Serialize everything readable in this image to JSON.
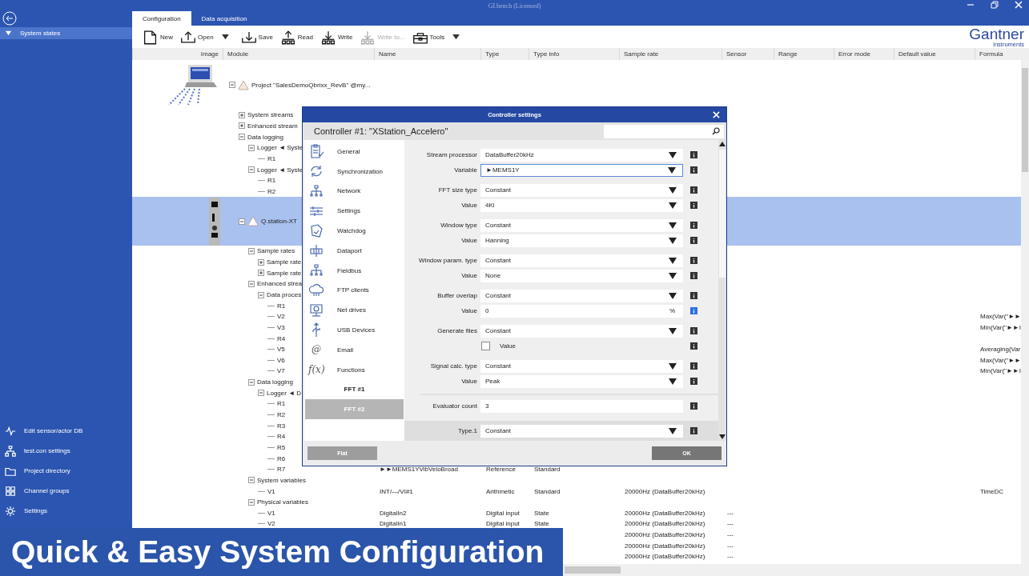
{
  "window": {
    "title": "GI.bench (Licensed)"
  },
  "sidebar": {
    "top_items": [
      {
        "label": "System states",
        "expanded": true,
        "selected": true
      }
    ],
    "bottom_items": [
      {
        "label": "Edit sensor/actor DB"
      },
      {
        "label": "test.con settings"
      },
      {
        "label": "Project directory"
      },
      {
        "label": "Channel groups"
      },
      {
        "label": "Settings"
      }
    ]
  },
  "tabs": [
    {
      "label": "Configuration",
      "selected": true
    },
    {
      "label": "Data acquisition",
      "selected": false
    }
  ],
  "toolbar": [
    {
      "label": "New",
      "disabled": false,
      "dropdown": false
    },
    {
      "label": "Open",
      "disabled": false,
      "dropdown": true
    },
    {
      "label": "Save",
      "disabled": false,
      "dropdown": false
    },
    {
      "label": "Read",
      "disabled": false,
      "dropdown": false
    },
    {
      "label": "Write",
      "disabled": false,
      "dropdown": false
    },
    {
      "label": "Write to...",
      "disabled": true,
      "dropdown": false
    },
    {
      "label": "Tools",
      "disabled": false,
      "dropdown": true
    }
  ],
  "logo": {
    "name": "Gantner",
    "sub": "instruments"
  },
  "table": {
    "columns": [
      "Image",
      "Module",
      "Name",
      "Type",
      "Type info",
      "Sample rate",
      "Sensor",
      "Range",
      "Error mode",
      "Default value",
      "Formula"
    ]
  },
  "tree": [
    {
      "label": "Project \"SalesDemoQbrixx_RevB\" @my...",
      "kind": "project",
      "expanded": true,
      "selected": false,
      "children": [
        {
          "label": "System streams",
          "kind": "folder",
          "expanded": false,
          "selected": false
        },
        {
          "label": "Enhanced stream",
          "kind": "folder",
          "expanded": false,
          "selected": false
        },
        {
          "label": "Data logging",
          "kind": "folder",
          "expanded": true,
          "selected": false,
          "children": [
            {
              "label": "Logger ◄ Syste",
              "kind": "folder",
              "expanded": true,
              "selected": false,
              "children": [
                {
                  "label": "R1",
                  "kind": "channel",
                  "selected": false
                }
              ]
            },
            {
              "label": "Logger ◄ Syste",
              "kind": "folder",
              "expanded": true,
              "selected": false,
              "children": [
                {
                  "label": "R1",
                  "kind": "channel",
                  "selected": false
                },
                {
                  "label": "R2",
                  "kind": "channel",
                  "selected": false
                }
              ]
            }
          ]
        },
        {
          "label": "Q.station-XT",
          "kind": "controller",
          "expanded": true,
          "selected": true,
          "children": [
            {
              "label": "Sample rates",
              "kind": "folder",
              "expanded": true,
              "selected": false,
              "children": [
                {
                  "label": "Sample rate",
                  "kind": "folder",
                  "expanded": false,
                  "selected": false
                },
                {
                  "label": "Sample rate",
                  "kind": "folder",
                  "expanded": false,
                  "selected": false
                }
              ]
            },
            {
              "label": "Enhanced strea",
              "kind": "folder",
              "expanded": true,
              "selected": false,
              "children": [
                {
                  "label": "Data proces",
                  "kind": "folder",
                  "expanded": true,
                  "selected": false,
                  "children": [
                    {
                      "label": "R1",
                      "kind": "channel",
                      "selected": false
                    },
                    {
                      "label": "V2",
                      "kind": "channel",
                      "selected": false,
                      "cells": {
                        "formula": "Max(Var(\"►►"
                      }
                    },
                    {
                      "label": "V3",
                      "kind": "channel",
                      "selected": false,
                      "cells": {
                        "formula": "Min(Var(\"►►I"
                      }
                    },
                    {
                      "label": "R4",
                      "kind": "channel",
                      "selected": false
                    },
                    {
                      "label": "V5",
                      "kind": "channel",
                      "selected": false,
                      "cells": {
                        "formula": "Averaging(Var"
                      }
                    },
                    {
                      "label": "V6",
                      "kind": "channel",
                      "selected": false,
                      "cells": {
                        "formula": "Max(Var(\"►►"
                      }
                    },
                    {
                      "label": "V7",
                      "kind": "channel",
                      "selected": false,
                      "cells": {
                        "formula": "Min(Var(\"►►I"
                      }
                    }
                  ]
                }
              ]
            },
            {
              "label": "Data logging",
              "kind": "folder",
              "expanded": true,
              "selected": false,
              "children": [
                {
                  "label": "Logger ◄ D",
                  "kind": "folder",
                  "expanded": true,
                  "selected": false,
                  "children": [
                    {
                      "label": "R1",
                      "kind": "channel",
                      "selected": false
                    },
                    {
                      "label": "R2",
                      "kind": "channel",
                      "selected": false
                    },
                    {
                      "label": "R3",
                      "kind": "channel",
                      "selected": false
                    },
                    {
                      "label": "R4",
                      "kind": "channel",
                      "selected": false
                    },
                    {
                      "label": "R5",
                      "kind": "channel",
                      "selected": false
                    },
                    {
                      "label": "R6",
                      "kind": "channel",
                      "selected": false
                    },
                    {
                      "label": "R7",
                      "kind": "channel",
                      "selected": false,
                      "cells": {
                        "name": "►►MEMS1YVibVeloBroad",
                        "type": "Reference",
                        "type_info": "Standard"
                      }
                    }
                  ]
                }
              ]
            },
            {
              "label": "System variables",
              "kind": "folder",
              "expanded": true,
              "selected": false,
              "children": [
                {
                  "label": "V1",
                  "kind": "channel",
                  "selected": false,
                  "cells": {
                    "name": "INT/—/VI#1",
                    "type": "Arithmetic",
                    "type_info": "Standard",
                    "sample_rate": "20000Hz (DataBuffer20kHz)",
                    "formula": "TimeDC"
                  }
                }
              ]
            },
            {
              "label": "Physical variables",
              "kind": "folder",
              "expanded": true,
              "selected": false,
              "children": [
                {
                  "label": "V1",
                  "kind": "channel",
                  "selected": false,
                  "cells": {
                    "name": "DigitalIn2",
                    "type": "Digital input",
                    "type_info": "State",
                    "sample_rate": "20000Hz (DataBuffer20kHz)",
                    "sensor": "---"
                  }
                },
                {
                  "label": "V2",
                  "kind": "channel",
                  "selected": false,
                  "cells": {
                    "name": "DigitalIn1",
                    "type": "Digital input",
                    "type_info": "State",
                    "sample_rate": "20000Hz (DataBuffer20kHz)",
                    "sensor": "---"
                  }
                },
                {
                  "kind": "channel",
                  "selected": false,
                  "cells": {
                    "sample_rate": "20000Hz (DataBuffer20kHz)",
                    "sensor": "---"
                  }
                },
                {
                  "kind": "channel",
                  "selected": false,
                  "cells": {
                    "sample_rate": "20000Hz (DataBuffer20kHz)",
                    "sensor": "---"
                  }
                },
                {
                  "kind": "channel",
                  "selected": false,
                  "cells": {
                    "sample_rate": "20000Hz (DataBuffer20kHz)",
                    "sensor": "---"
                  }
                }
              ]
            }
          ]
        }
      ]
    }
  ],
  "dialog": {
    "title": "Controller settings",
    "heading": "Controller #1: \"XStation_Accelero\"",
    "nav": [
      {
        "label": "General",
        "kind": "section",
        "selected": false
      },
      {
        "label": "Synchronization",
        "kind": "section",
        "selected": false
      },
      {
        "label": "Network",
        "kind": "section",
        "selected": false
      },
      {
        "label": "Settings",
        "kind": "section",
        "selected": false
      },
      {
        "label": "Watchdog",
        "kind": "section",
        "selected": false
      },
      {
        "label": "Dataport",
        "kind": "section",
        "selected": false
      },
      {
        "label": "Fieldbus",
        "kind": "section",
        "selected": false
      },
      {
        "label": "FTP clients",
        "kind": "section",
        "selected": false
      },
      {
        "label": "Net drives",
        "kind": "section",
        "selected": false
      },
      {
        "label": "USB Devices",
        "kind": "section",
        "selected": false
      },
      {
        "label": "Email",
        "kind": "section",
        "selected": false,
        "glyph": "@"
      },
      {
        "label": "Functions",
        "kind": "section",
        "selected": false,
        "glyph": "f(x)"
      },
      {
        "label": "FFT #1",
        "kind": "sub",
        "selected": false
      },
      {
        "label": "FFT #2",
        "kind": "sub",
        "selected": true
      }
    ],
    "groups": [
      {
        "kind": "plain",
        "rows": [
          {
            "label": "Stream processor",
            "kind": "select",
            "value": "DataBuffer20kHz",
            "focused": false,
            "info_selected": false
          },
          {
            "label": "Variable",
            "kind": "select",
            "value": "►MEMS1Y",
            "focused": true,
            "info_selected": false
          }
        ]
      },
      {
        "kind": "plain",
        "rows": [
          {
            "label": "FFT size type",
            "kind": "select",
            "value": "Constant",
            "focused": false,
            "info_selected": false
          },
          {
            "label": "Value",
            "kind": "select",
            "value": "4Ki",
            "focused": false,
            "info_selected": false
          }
        ]
      },
      {
        "kind": "plain",
        "rows": [
          {
            "label": "Window type",
            "kind": "select",
            "value": "Constant",
            "focused": false,
            "info_selected": false
          },
          {
            "label": "Value",
            "kind": "select",
            "value": "Hanning",
            "focused": false,
            "info_selected": false
          }
        ]
      },
      {
        "kind": "plain",
        "rows": [
          {
            "label": "Window param. type",
            "kind": "select",
            "value": "Constant",
            "focused": false,
            "info_selected": false
          },
          {
            "label": "Value",
            "kind": "select",
            "value": "None",
            "focused": false,
            "info_selected": false
          }
        ]
      },
      {
        "kind": "plain",
        "rows": [
          {
            "label": "Buffer overlap",
            "kind": "select",
            "value": "Constant",
            "focused": false,
            "info_selected": false
          },
          {
            "label": "Value",
            "kind": "number",
            "value": "0",
            "unit": "%",
            "focused": false,
            "info_selected": true
          }
        ]
      },
      {
        "kind": "plain",
        "rows": [
          {
            "label": "Generate files",
            "kind": "select",
            "value": "Constant",
            "focused": false,
            "info_selected": false
          },
          {
            "label": "Value",
            "kind": "checkbox",
            "checked": false,
            "info_selected": false
          }
        ]
      },
      {
        "kind": "plain",
        "rows": [
          {
            "label": "Signal calc. type",
            "kind": "select",
            "value": "Constant",
            "focused": false,
            "info_selected": false
          },
          {
            "label": "Value",
            "kind": "select",
            "value": "Peak",
            "focused": false,
            "info_selected": false
          }
        ]
      },
      {
        "kind": "ruled",
        "rows": [
          {
            "label": "Evaluator count",
            "kind": "text",
            "value": "3",
            "focused": false,
            "info_selected": false
          }
        ]
      },
      {
        "kind": "shaded",
        "rows": [
          {
            "label": "Type.1",
            "kind": "select",
            "value": "Constant",
            "focused": false,
            "info_selected": false
          }
        ]
      }
    ],
    "buttons": [
      {
        "label": "Flat",
        "disabled": true
      },
      {
        "label": "OK",
        "disabled": false
      }
    ]
  },
  "banner": {
    "text": "Quick & Easy System Configuration"
  }
}
